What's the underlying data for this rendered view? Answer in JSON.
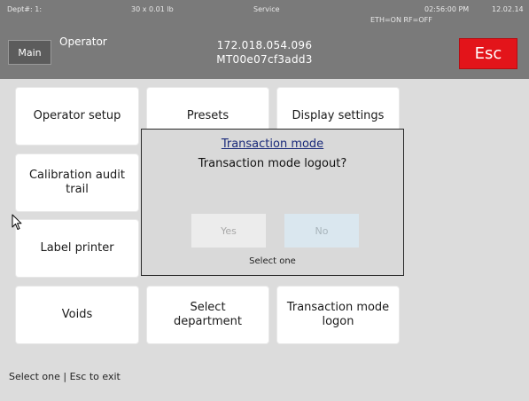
{
  "status_bar": {
    "dept": "Dept#: 1:",
    "capacity": "30 x 0.01 lb",
    "mode": "Service",
    "time": "02:56:00 PM",
    "date": "12.02.14",
    "network": "ETH=ON RF=OFF"
  },
  "header": {
    "main_label": "Main",
    "title": "Operator",
    "ip_address": "172.018.054.096",
    "device_id": "MT00e07cf3add3",
    "esc_label": "Esc"
  },
  "tiles": [
    "Operator setup",
    "Presets",
    "Display settings",
    "Calibration audit trail",
    "Label printer",
    "Voids",
    "Select department",
    "Transaction mode logon"
  ],
  "dialog": {
    "title": "Transaction mode",
    "question": "Transaction mode logout?",
    "yes_label": "Yes",
    "no_label": "No",
    "hint": "Select one"
  },
  "footer": {
    "hint": "Select one | Esc to exit"
  },
  "colors": {
    "header_bg": "#7a7a7a",
    "esc_red": "#e3141a",
    "background": "#dcdcdc"
  },
  "icons": {
    "cursor": "mouse-pointer-icon"
  }
}
